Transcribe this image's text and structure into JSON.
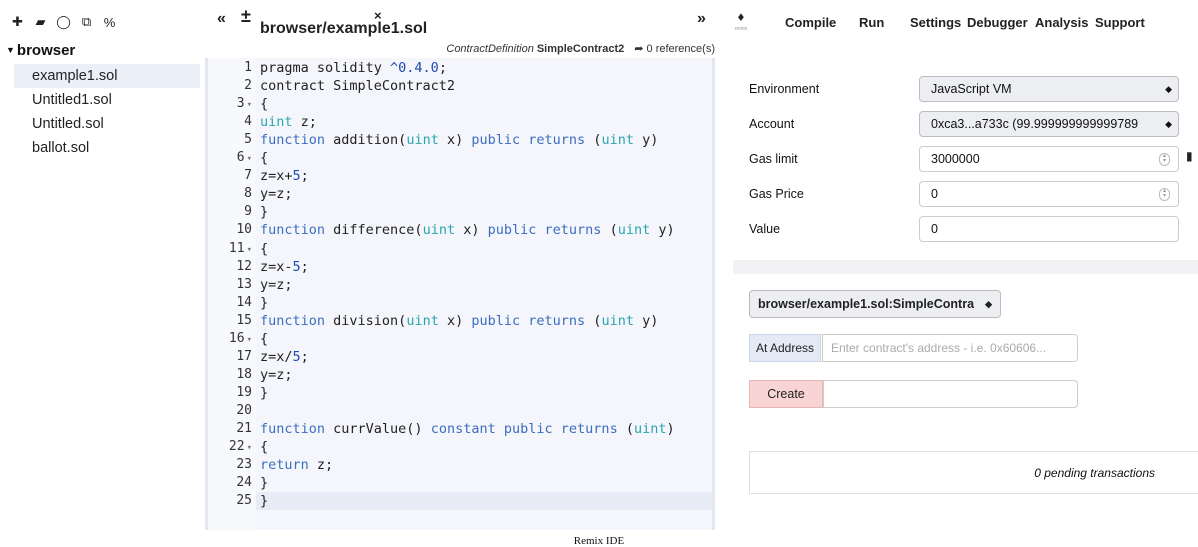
{
  "file_toolbar": {
    "icons": [
      "new-file-icon",
      "open-folder-icon",
      "github-icon",
      "copy-icon",
      "link-icon"
    ],
    "glyphs": [
      "✚",
      "▰",
      "◯",
      "⧉",
      "%"
    ]
  },
  "file_explorer": {
    "root": "browser",
    "files": [
      "example1.sol",
      "Untitled1.sol",
      "Untitled.sol",
      "ballot.sol"
    ]
  },
  "editor_tabs": {
    "collapse_left": "«",
    "new_file": "±",
    "active_tab": "browser/example1.sol",
    "close": "×",
    "collapse_right": "»",
    "logo_label": "remix"
  },
  "context": {
    "type": "ContractDefinition",
    "name": "SimpleContract2",
    "refs": "0 reference(s)"
  },
  "code": {
    "line_numbers": [
      "1",
      "2",
      "3",
      "4",
      "5",
      "6",
      "7",
      "8",
      "9",
      "10",
      "11",
      "12",
      "13",
      "14",
      "15",
      "16",
      "17",
      "18",
      "19",
      "20",
      "21",
      "22",
      "23",
      "24",
      "25"
    ],
    "fold_lines": [
      3,
      6,
      11,
      16,
      22
    ],
    "lines": [
      "pragma solidity ^0.4.0;",
      "contract SimpleContract2",
      "{",
      "uint z;",
      "function addition(uint x) public returns (uint y)",
      "{",
      "z=x+5;",
      "y=z;",
      "}",
      "function difference(uint x) public returns (uint y)",
      "{",
      "z=x-5;",
      "y=z;",
      "}",
      "function division(uint x) public returns (uint y)",
      "{",
      "z=x/5;",
      "y=z;",
      "}",
      "",
      "function currValue() constant public returns (uint)",
      "{",
      "return z;",
      "}",
      "}"
    ]
  },
  "right_tabs": [
    "Compile",
    "Run",
    "Settings",
    "Debugger",
    "Analysis",
    "Support"
  ],
  "run": {
    "environment_label": "Environment",
    "environment_value": "JavaScript VM",
    "account_label": "Account",
    "account_value": "0xca3...a733c (99.999999999999789",
    "gas_limit_label": "Gas limit",
    "gas_limit_value": "3000000",
    "gas_price_label": "Gas Price",
    "gas_price_value": "0",
    "value_label": "Value",
    "value_value": "0",
    "contract_select": "browser/example1.sol:SimpleContra",
    "at_address_button": "At Address",
    "at_address_placeholder": "Enter contract's address - i.e. 0x60606...",
    "create_button": "Create",
    "pending": "0 pending transactions"
  },
  "caption": "Remix IDE"
}
